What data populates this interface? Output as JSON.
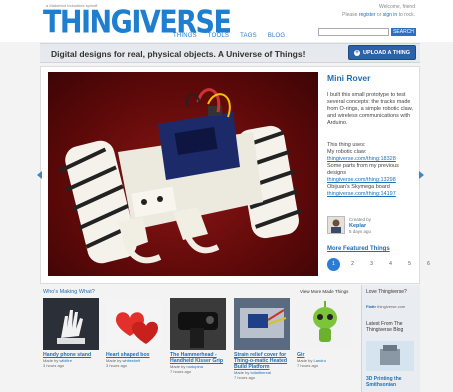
{
  "header": {
    "byline": "a Makerbot Industries spinoff",
    "logo": "THINGIVERSE",
    "nav": [
      "THINGS",
      "TOOLS",
      "TAGS",
      "BLOG"
    ],
    "welcome": "Welcome, friend",
    "account_prefix": "Please",
    "register": "register",
    "or": "or",
    "signin": "sign in",
    "account_suffix": "to rock.",
    "search_placeholder": "",
    "search_button": "SEARCH"
  },
  "tagline": "Digital designs for real, physical objects. A Universe of Things!",
  "upload_label": "UPLOAD A THING",
  "featured": {
    "title": "Mini Rover",
    "description": "I built this small prototype to test several concepts: the tracks made from O-rings, a simple robotic claw, and wireless communications with Arduino.",
    "uses_heading": "This thing uses:",
    "uses_1_label": "My robotic claw:",
    "uses_1_link": "thingiverse.com/thing:18328",
    "uses_2_label": "Some parts from my previous designs",
    "uses_2_link": "thingiverse.com/thing:13298",
    "uses_3_label": "Obijuan's Skymega board",
    "uses_3_link": "thingiverse.com/thing:14197",
    "created_by": "Created by",
    "creator": "Keplar",
    "created_ago": "5 days ago",
    "more_label": "More Featured Things",
    "pages": [
      "1",
      "2",
      "3",
      "4",
      "5",
      "6"
    ]
  },
  "making": {
    "heading": "Who's Making What?",
    "view_more": "View More Made Things",
    "cards": [
      {
        "title": "Handy phone stand",
        "by_prefix": "Made by",
        "by": "wildfire",
        "ago": "3 hours ago"
      },
      {
        "title": "Heart shaped box",
        "by_prefix": "Made by",
        "by": "whiteshelf",
        "ago": "3 hours ago"
      },
      {
        "title": "The Hammerhead - Handheld Kisser Grip",
        "by_prefix": "Made by",
        "by": "nodopina",
        "ago": "7 hours ago"
      },
      {
        "title": "Strain relief cover for Thing-o-matic Heated Build Platform",
        "by_prefix": "Made by",
        "by": "tollalthereal",
        "ago": "7 hours ago"
      },
      {
        "title": "Gir",
        "by_prefix": "Made by",
        "by": "Landru",
        "ago": "7 hours ago"
      }
    ]
  },
  "sidebar": {
    "love": "Love Thingiverse?",
    "link_icon": "flattr-icon",
    "link_label": "Flattr",
    "link_text": "thingiverse.com",
    "latest": "Latest From The Thingiverse Blog",
    "blog_title": "3D Printing the Smithsonian"
  },
  "colors": {
    "brand": "#1e7fd1",
    "link": "#1d6fb8",
    "button": "#2d62a8",
    "hero_bg": "#6a0c0c"
  }
}
